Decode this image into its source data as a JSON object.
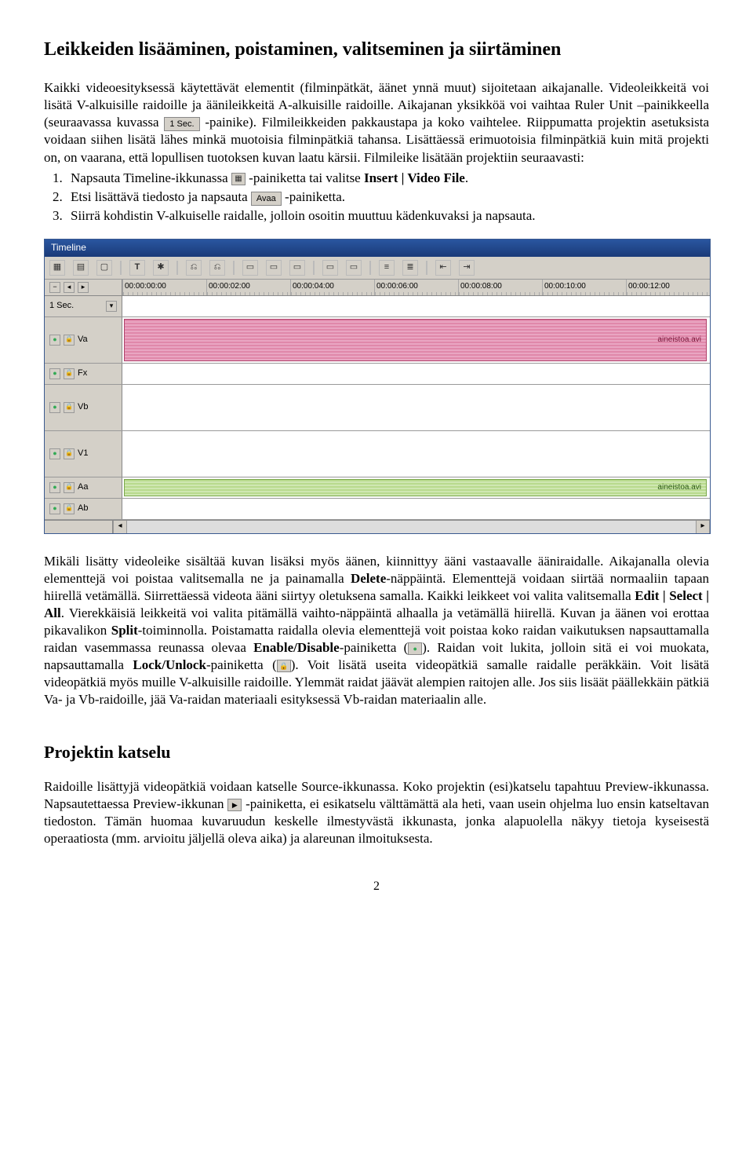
{
  "heading1": "Leikkeiden lisääminen, poistaminen, valitseminen ja siirtäminen",
  "para1a": "Kaikki videoesityksessä käytettävät elementit (filminpätkät, äänet ynnä muut) sijoitetaan aikajanalle. Videoleikkeitä voi lisätä V-alkuisille raidoille ja äänileikkeitä A-alkuisille raidoille. Aikajanan yksikköä voi vaihtaa Ruler Unit –painikkeella (seuraavassa kuvassa ",
  "para1b": "-painike). Filmileikkeiden pakkaustapa ja koko vaihtelee. Riippumatta projektin asetuksista voidaan siihen lisätä lähes minkä muotoisia filminpätkiä tahansa. Lisättäessä erimuotoisia filminpätkiä kuin mitä projekti on, on vaarana, että lopullisen tuotoksen kuvan laatu kärsii. Filmileike lisätään projektiin seuraavasti:",
  "btn_1sec": "1 Sec.",
  "ol1_a": "Napsauta Timeline-ikkunassa ",
  "ol1_b": "-painiketta tai valitse ",
  "ol1_c": "Insert | Video File",
  "ol1_d": ".",
  "ol2_a": "Etsi lisättävä tiedosto ja napsauta ",
  "btn_avaa": "Avaa",
  "ol2_b": "-painiketta.",
  "ol3": "Siirrä kohdistin V-alkuiselle raidalle, jolloin osoitin muuttuu kädenkuvaksi ja napsauta.",
  "timeline": {
    "title": "Timeline",
    "unit": "1 Sec.",
    "ticks": [
      "00:00:00:00",
      "00:00:02:00",
      "00:00:04:00",
      "00:00:06:00",
      "00:00:08:00",
      "00:00:10:00",
      "00:00:12:00"
    ],
    "tracks": [
      {
        "label": "Va",
        "clip": "aineistoa.avi",
        "clipType": "video",
        "tall": true
      },
      {
        "label": "Fx",
        "clip": null,
        "thin": true
      },
      {
        "label": "Vb",
        "clip": null,
        "tall": true
      },
      {
        "label": "V1",
        "clip": null,
        "tall": true
      },
      {
        "label": "Aa",
        "clip": "aineistoa.avi",
        "clipType": "audio",
        "thin": true
      },
      {
        "label": "Ab",
        "clip": null,
        "thin": true
      }
    ]
  },
  "para2a": "Mikäli lisätty videoleike sisältää kuvan lisäksi myös äänen, kiinnittyy ääni vastaavalle ääniraidalle. Aikajanalla olevia elementtejä voi poistaa valitsemalla ne ja painamalla ",
  "bold_delete": "Delete",
  "para2b": "-näppäintä. Elementtejä voidaan siirtää normaaliin tapaan hiirellä vetämällä. Siirrettäessä videota ääni siirtyy oletuksena samalla. Kaikki leikkeet voi valita valitsemalla ",
  "bold_editselectall": "Edit | Select | All",
  "para2c": ". Vierekkäisiä leikkeitä voi valita pitämällä vaihto-näppäintä alhaalla ja vetämällä hiirellä. Kuvan ja äänen voi erottaa pikavalikon ",
  "bold_split": "Split",
  "para2d": "-toiminnolla. Poistamatta raidalla olevia elementtejä voit poistaa koko raidan vaikutuksen napsauttamalla raidan vasemmassa reunassa olevaa ",
  "bold_enable": "Enable/Disable",
  "para2e": "-painiketta (",
  "para2f": "). Raidan voit lukita, jolloin sitä ei voi muokata, napsauttamalla ",
  "bold_lock": "Lock/Unlock",
  "para2g": "-painiketta (",
  "para2h": "). Voit lisätä useita videopätkiä samalle raidalle peräkkäin. Voit lisätä videopätkiä myös muille V-alkuisille raidoille. Ylemmät raidat jäävät alempien raitojen alle. Jos siis lisäät päällekkäin pätkiä Va- ja Vb-raidoille, jää Va-raidan materiaali esityksessä Vb-raidan materiaalin alle.",
  "heading2": "Projektin katselu",
  "para3a": "Raidoille lisättyjä videopätkiä voidaan katselle Source-ikkunassa. Koko projektin (esi)katselu tapahtuu Preview-ikkunassa. Napsautettaessa Preview-ikkunan ",
  "para3b": "-painiketta, ei esikatselu välttämättä ala heti, vaan usein ohjelma luo ensin katseltavan tiedoston. Tämän huomaa kuvaruudun keskelle ilmestyvästä ikkunasta, jonka alapuolella näkyy tietoja kyseisestä operaatiosta (mm. arvioitu jäljellä oleva aika) ja alareunan ilmoituksesta.",
  "page_number": "2"
}
